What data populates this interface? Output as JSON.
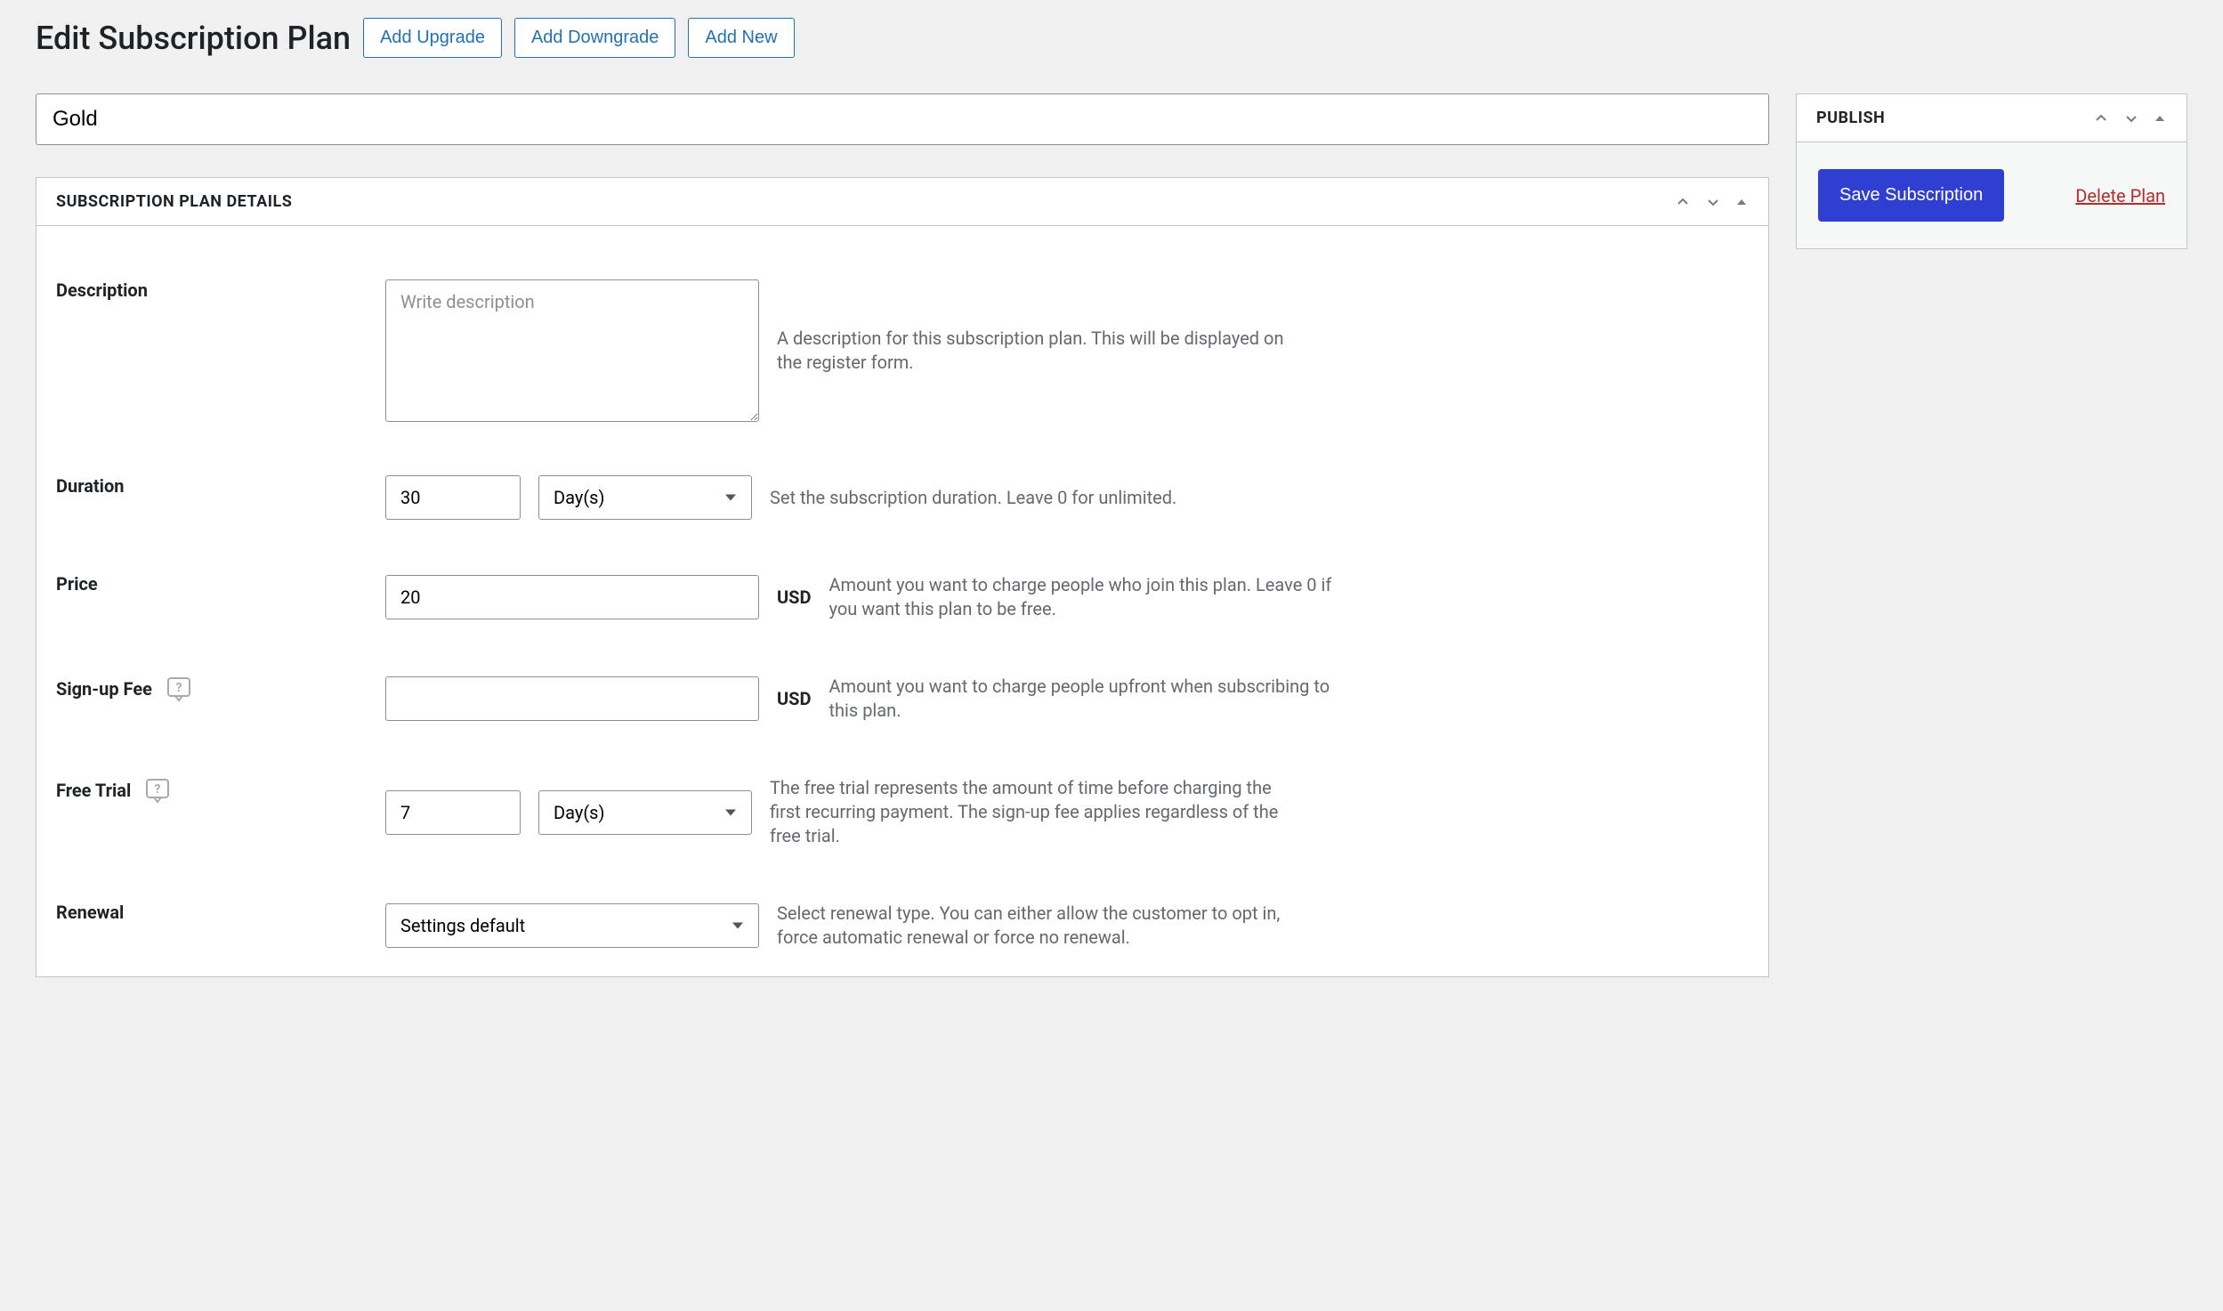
{
  "header": {
    "title": "Edit Subscription Plan",
    "buttons": {
      "upgrade": "Add Upgrade",
      "downgrade": "Add Downgrade",
      "new": "Add New"
    }
  },
  "plan": {
    "name": "Gold"
  },
  "details_box": {
    "title": "Subscription Plan Details"
  },
  "fields": {
    "description": {
      "label": "Description",
      "value": "",
      "placeholder": "Write description",
      "help": "A description for this subscription plan. This will be displayed on the register form."
    },
    "duration": {
      "label": "Duration",
      "value": "30",
      "unit": "Day(s)",
      "help": "Set the subscription duration. Leave 0 for unlimited."
    },
    "price": {
      "label": "Price",
      "value": "20",
      "currency": "USD",
      "help": "Amount you want to charge people who join this plan. Leave 0 if you want this plan to be free."
    },
    "signup_fee": {
      "label": "Sign-up Fee",
      "value": "",
      "currency": "USD",
      "help": "Amount you want to charge people upfront when subscribing to this plan."
    },
    "free_trial": {
      "label": "Free Trial",
      "value": "7",
      "unit": "Day(s)",
      "help": "The free trial represents the amount of time before charging the first recurring payment. The sign-up fee applies regardless of the free trial."
    },
    "renewal": {
      "label": "Renewal",
      "value": "Settings default",
      "help": "Select renewal type. You can either allow the customer to opt in, force automatic renewal or force no renewal."
    }
  },
  "publish": {
    "title": "Publish",
    "save": "Save Subscription",
    "delete": "Delete Plan"
  }
}
